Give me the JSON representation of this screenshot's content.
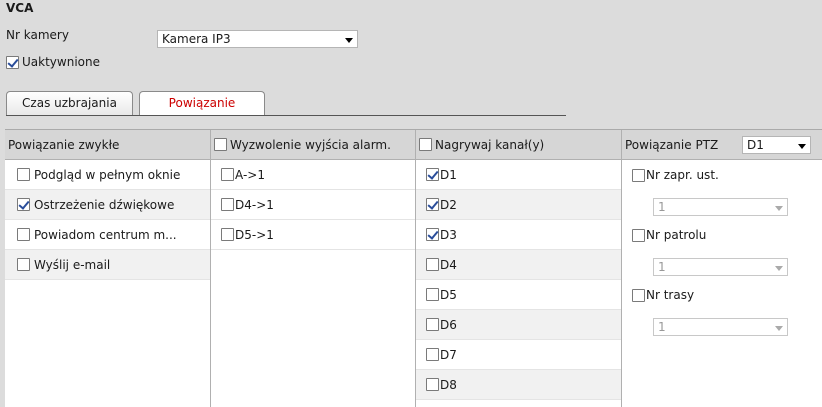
{
  "page": {
    "title": "VCA"
  },
  "camera": {
    "label": "Nr kamery",
    "selected": "Kamera IP3"
  },
  "enable": {
    "label": "Uaktywnione",
    "checked": true
  },
  "tabs": [
    {
      "label": "Czas uzbrajania",
      "active": false
    },
    {
      "label": "Powiązanie",
      "active": true
    }
  ],
  "colors": {
    "active_tab_text": "#cc0000",
    "header_bg": "#d6d6d6",
    "page_bg": "#dcdcdc"
  },
  "linkage": {
    "normal": {
      "header": "Powiązanie zwykłe",
      "items": [
        {
          "label": "Podgląd w pełnym oknie",
          "checked": false
        },
        {
          "label": "Ostrzeżenie dźwiękowe",
          "checked": true
        },
        {
          "label": "Powiadom centrum m...",
          "checked": false
        },
        {
          "label": "Wyślij e-mail",
          "checked": false
        }
      ]
    },
    "alarm_output": {
      "header": "Wyzwolenie wyjścia alarm.",
      "items": [
        {
          "label": "A->1",
          "checked": false
        },
        {
          "label": "D4->1",
          "checked": false
        },
        {
          "label": "D5->1",
          "checked": false
        }
      ]
    },
    "record": {
      "header": "Nagrywaj kanał(y)",
      "items": [
        {
          "label": "D1",
          "checked": true
        },
        {
          "label": "D2",
          "checked": true
        },
        {
          "label": "D3",
          "checked": true
        },
        {
          "label": "D4",
          "checked": false
        },
        {
          "label": "D5",
          "checked": false
        },
        {
          "label": "D6",
          "checked": false
        },
        {
          "label": "D7",
          "checked": false
        },
        {
          "label": "D8",
          "checked": false
        }
      ]
    },
    "ptz": {
      "header": "Powiązanie PTZ",
      "channel": "D1",
      "items": [
        {
          "label": "Nr zapr. ust.",
          "checked": false,
          "value": "1"
        },
        {
          "label": "Nr patrolu",
          "checked": false,
          "value": "1"
        },
        {
          "label": "Nr trasy",
          "checked": false,
          "value": "1"
        }
      ]
    }
  }
}
